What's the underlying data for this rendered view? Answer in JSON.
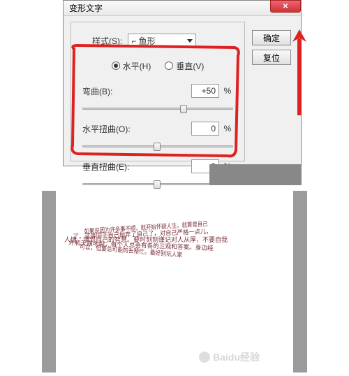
{
  "dialog": {
    "title": "变形文字",
    "close": "✕",
    "style_label": "样式(S):",
    "style_value": "⌐ 鱼形",
    "radio_h": "水平(H)",
    "radio_v": "垂直(V)",
    "bend_label": "弯曲(B):",
    "bend_value": "+50",
    "hdist_label": "水平扭曲(O):",
    "hdist_value": "0",
    "vdist_label": "垂直扭曲(E):",
    "vdist_value": "0",
    "pct": "%",
    "ok": "确定",
    "reset": "复位"
  },
  "result": {
    "lines": [
      "如果说因为许多事不顺，就开始怀疑人生，就算是自己",
      "了，这等同于自己抛弃了自己了，对自己严格一点儿，",
      "人情，填到自己的智慧。要时刻刻谨记对人从厚，不要自我",
      "坏和天崩地裂，每个人总会有各的三观和答案。身边经",
      "可以，但要总可能的去帮忙。最好别坑人家"
    ]
  },
  "watermark": "Baidu经验"
}
